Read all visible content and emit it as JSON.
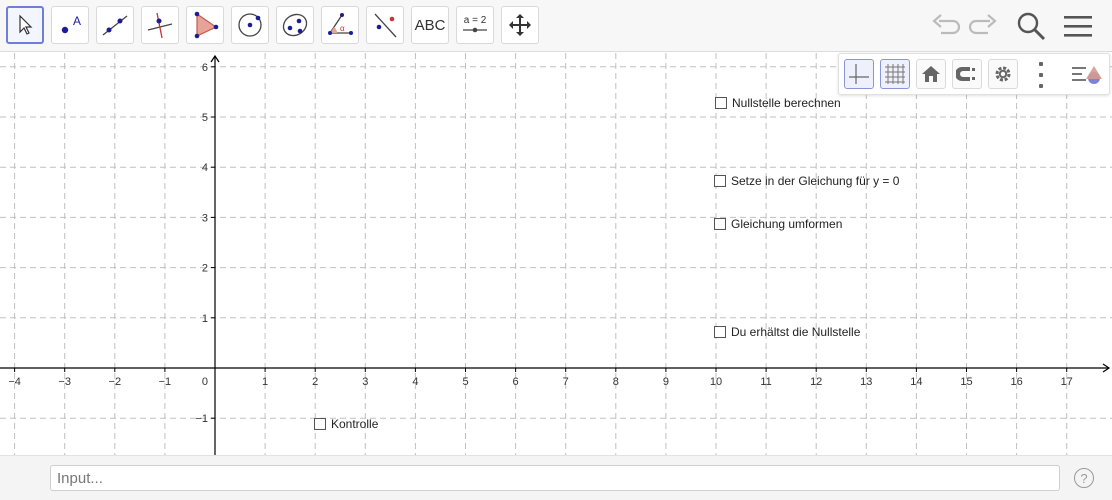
{
  "toolbar": {
    "tools": [
      {
        "name": "move-tool",
        "selected": true
      },
      {
        "name": "point-tool"
      },
      {
        "name": "line-tool"
      },
      {
        "name": "perpendicular-line-tool"
      },
      {
        "name": "polygon-tool"
      },
      {
        "name": "circle-tool"
      },
      {
        "name": "ellipse-tool"
      },
      {
        "name": "angle-tool"
      },
      {
        "name": "reflect-tool"
      },
      {
        "name": "text-tool",
        "label": "ABC"
      },
      {
        "name": "slider-tool",
        "label": "a = 2"
      },
      {
        "name": "move-graphics-view-tool"
      }
    ],
    "undo_icon": "undo-icon",
    "redo_icon": "redo-icon",
    "search_icon": "search-icon",
    "menu_icon": "menu-icon"
  },
  "graphics": {
    "x_ticks": [
      "−4",
      "−3",
      "−2",
      "−1",
      "1",
      "2",
      "3",
      "4",
      "5",
      "6",
      "7",
      "8",
      "9",
      "10",
      "11",
      "12",
      "13",
      "14",
      "15",
      "16",
      "17"
    ],
    "y_ticks": [
      "6",
      "5",
      "4",
      "3",
      "2",
      "1",
      "−1"
    ],
    "origin_label": "0",
    "axes_color": "#000000",
    "grid_color": "#c0c0c0",
    "checkboxes": [
      {
        "label": "Nullstelle berechnen",
        "checked": false
      },
      {
        "label": "Setze in der Gleichung für y = 0",
        "checked": false
      },
      {
        "label": "Gleichung umformen",
        "checked": false
      },
      {
        "label": "Du erhältst die Nullstelle",
        "checked": false
      },
      {
        "label": "Kontrolle",
        "checked": false
      }
    ]
  },
  "style_bar": {
    "buttons": [
      "axes-toggle-icon",
      "grid-toggle-icon",
      "home-icon",
      "point-capturing-icon",
      "settings-icon",
      "more-vertical-icon"
    ],
    "toggle_icon": "style-bar-toggle-icon"
  },
  "input_bar": {
    "placeholder": "Input...",
    "help_label": "?"
  },
  "colors": {
    "selected_tool_border": "#6e7fd8",
    "tool_point": "#1c1c99",
    "polygon_fill": "#e6a39a"
  }
}
